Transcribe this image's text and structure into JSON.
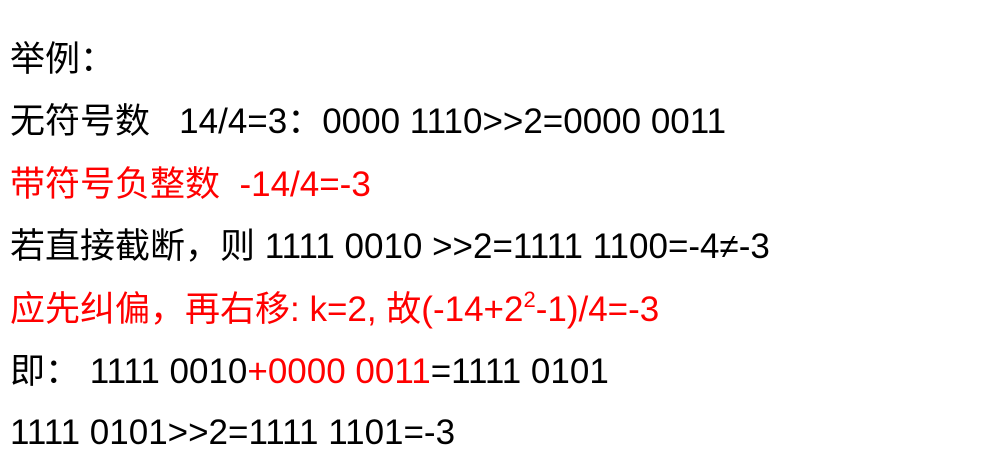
{
  "colors": {
    "text": "#000000",
    "highlight": "#ff0000"
  },
  "lines": {
    "l1": "举例：",
    "l2": "无符号数   14/4=3：0000 1110>>2=0000 0011",
    "l3": "带符号负整数  -14/4=-3",
    "l4": "若直接截断，则 1111 0010 >>2=1111 1100=-4≠-3",
    "l5a": "应先纠偏，再右移: k=2, 故(-14+2",
    "l5sup": "2",
    "l5b": "-1)/4=-3",
    "l6a": "即： 1111 0010",
    "l6b": "+0000 0011",
    "l6c": "=1111 0101",
    "l7": "1111 0101>>2=1111 1101=-3"
  }
}
